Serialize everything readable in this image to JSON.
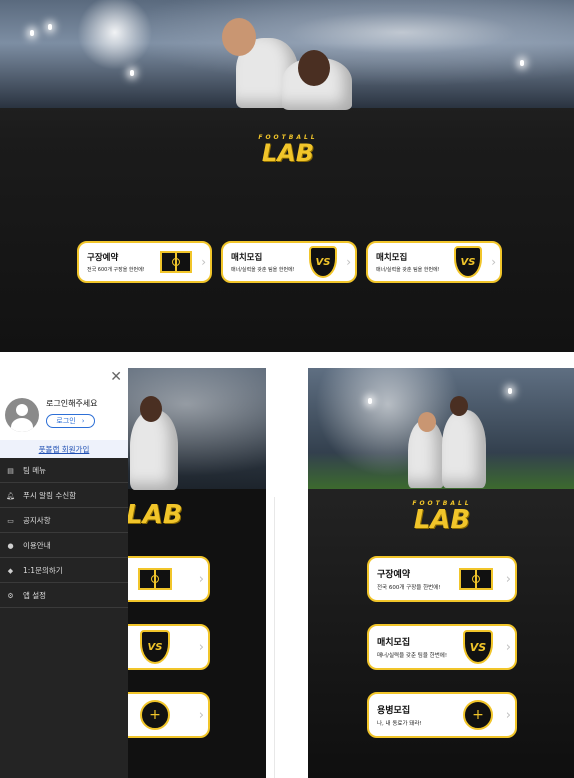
{
  "brand": {
    "logo_small": "FOOTBALL",
    "logo_big": "LAB",
    "accent": "#f1c52a"
  },
  "cards": [
    {
      "title": "구장예약",
      "subtitle": "전국 600개 구장을 한번에!",
      "icon": "soccer-field-icon"
    },
    {
      "title": "매치모집",
      "subtitle": "매너/실력을 갖춘 팀을 한번에!",
      "icon": "vs-shield-icon"
    },
    {
      "title": "매치모집",
      "subtitle": "매너/실력을 갖춘 팀을 한번에!",
      "icon": "vs-shield-icon"
    }
  ],
  "mobile_cards": [
    {
      "title": "구장예약",
      "subtitle": "전국 600개 구장을 한번에!",
      "icon": "soccer-field-icon"
    },
    {
      "title": "매치모집",
      "subtitle": "매너/실력을 갖춘 팀을 한번에!",
      "icon": "vs-shield-icon"
    },
    {
      "title": "용병모집",
      "subtitle": "나, 내 동료가 돼라!",
      "icon": "player-add-icon"
    }
  ],
  "drawer": {
    "login_prompt": "로그인해주세요",
    "login_button": "로그인",
    "signup_link": "풋볼랩 회원가입",
    "menu": [
      {
        "label": "팀 메뉴",
        "icon": "team-icon"
      },
      {
        "label": "푸시 알림 수신함",
        "icon": "bell-icon"
      },
      {
        "label": "공지사항",
        "icon": "notice-icon"
      },
      {
        "label": "이용안내",
        "icon": "info-icon"
      },
      {
        "label": "1:1문의하기",
        "icon": "inquiry-icon"
      },
      {
        "label": "앱 설정",
        "icon": "gear-icon"
      }
    ]
  },
  "glyphs": {
    "close": "✕",
    "chevron": "›",
    "vs": "VS"
  }
}
